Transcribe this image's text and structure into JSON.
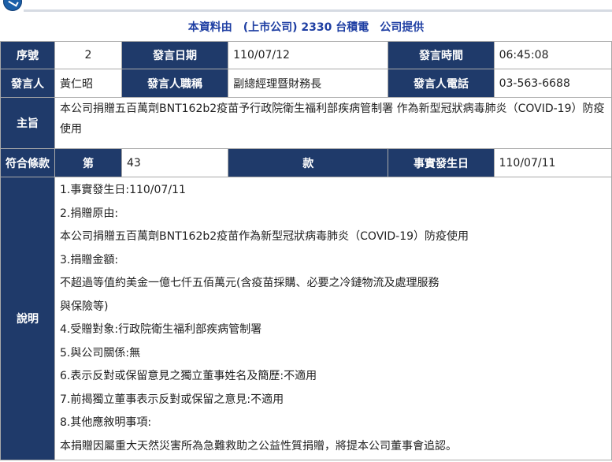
{
  "banner": "本資料由　(上市公司) 2330 台積電　公司提供",
  "labels": {
    "seq": "序號",
    "date": "發言日期",
    "time": "發言時間",
    "speaker": "發言人",
    "title": "發言人職稱",
    "phone": "發言人電話",
    "subject": "主旨",
    "clause": "符合條款",
    "di": "第",
    "kuan": "款",
    "event_date": "事實發生日",
    "desc": "說明"
  },
  "values": {
    "seq": "2",
    "date": "110/07/12",
    "time": "06:45:08",
    "speaker": "黃仁昭",
    "title": "副總經理暨財務長",
    "phone": "03-563-6688",
    "subject": "本公司捐贈五百萬劑BNT162b2疫苗予行政院衛生福利部疾病管制署 作為新型冠狀病毒肺炎（COVID-19）防疫使用",
    "clause_no": "43",
    "event_date": "110/07/11"
  },
  "description": [
    "1.事實發生日:110/07/11",
    "2.捐贈原由:",
    "本公司捐贈五百萬劑BNT162b2疫苗作為新型冠狀病毒肺炎（COVID-19）防疫使用",
    "3.捐贈金額:",
    "不超過等值約美金一億七仟五佰萬元(含疫苗採購、必要之冷鏈物流及處理服務",
    "與保險等)",
    "4.受贈對象:行政院衛生福利部疾病管制署",
    "5.與公司關係:無",
    "6.表示反對或保留意見之獨立董事姓名及簡歷:不適用",
    "7.前揭獨立董事表示反對或保留之意見:不適用",
    "8.其他應敘明事項:",
    "本捐贈因屬重大天然災害所為急難救助之公益性質捐贈，將提本公司董事會追認。"
  ]
}
